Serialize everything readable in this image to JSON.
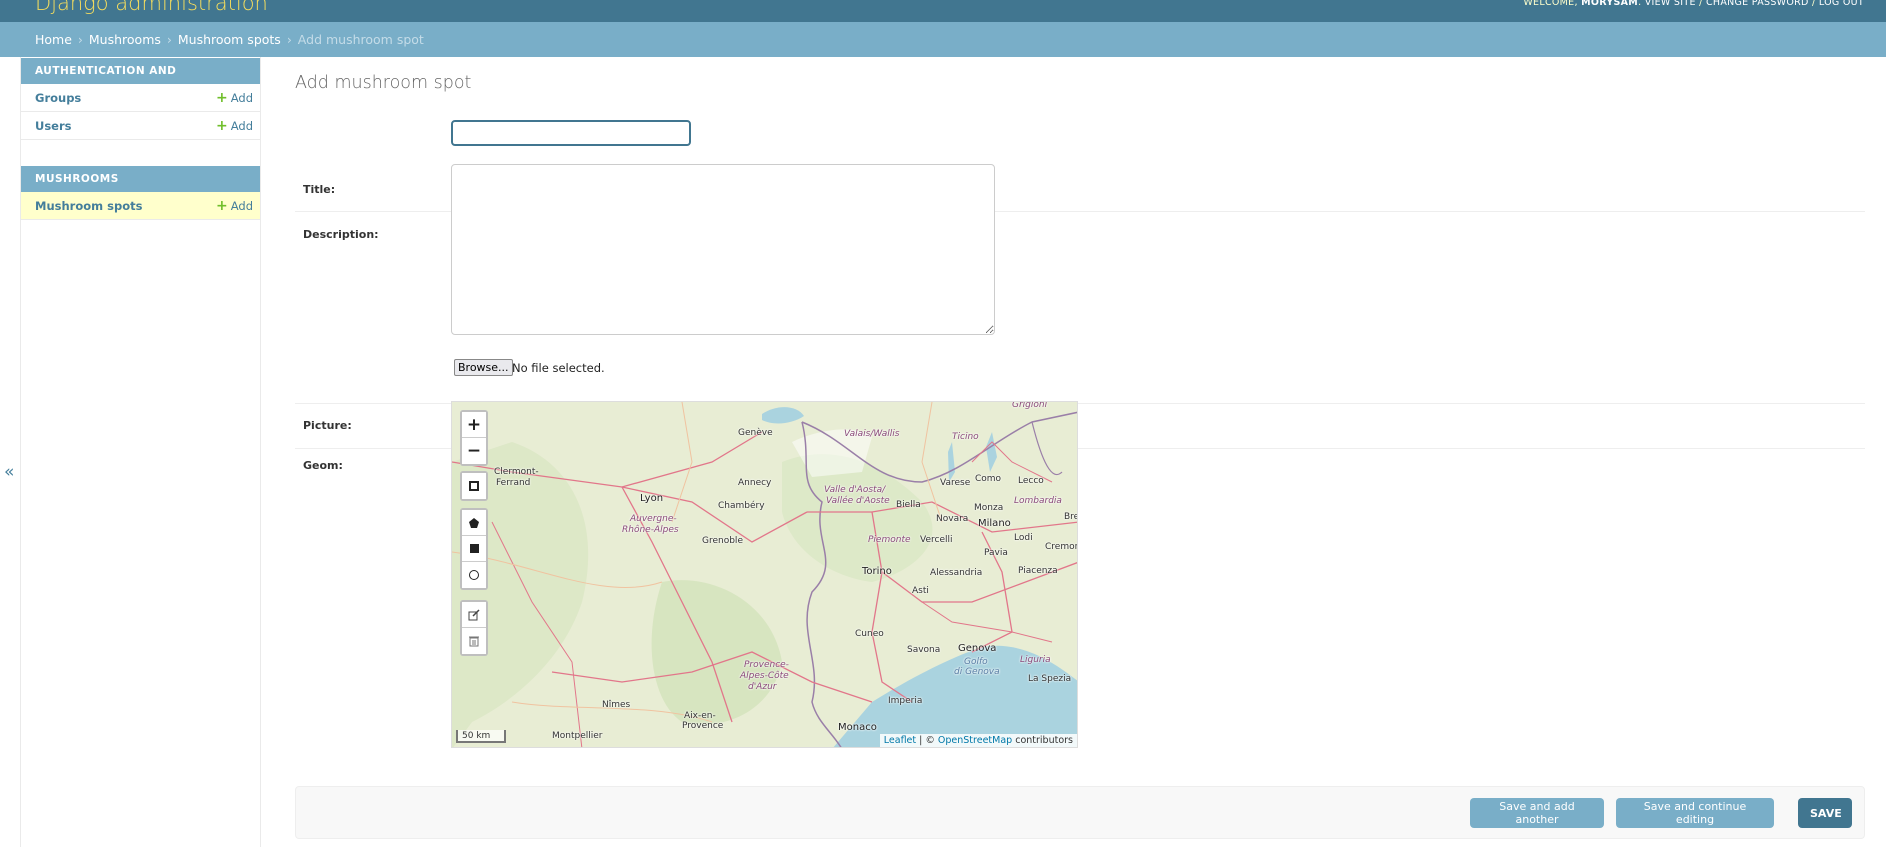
{
  "header": {
    "site_name": "Django administration",
    "welcome": "WELCOME,",
    "username": "MORYSAM",
    "view_site": "VIEW SITE",
    "change_password": "CHANGE PASSWORD",
    "log_out": "LOG OUT",
    "sep": "/"
  },
  "breadcrumbs": {
    "home": "Home",
    "app": "Mushrooms",
    "model": "Mushroom spots",
    "current": "Add mushroom spot",
    "sep": "›"
  },
  "sidebar": {
    "modules": [
      {
        "caption": "Authentication and Authorization",
        "rows": [
          {
            "label": "Groups",
            "add": "Add"
          },
          {
            "label": "Users",
            "add": "Add"
          }
        ]
      },
      {
        "caption": "Mushrooms",
        "rows": [
          {
            "label": "Mushroom spots",
            "add": "Add"
          }
        ]
      }
    ],
    "toggle_icon": "«"
  },
  "page": {
    "title": "Add mushroom spot"
  },
  "form": {
    "title_label": "Title:",
    "title_value": "",
    "description_label": "Description:",
    "description_value": "",
    "picture_label": "Picture:",
    "browse_label": "Browse...",
    "no_file": "No file selected.",
    "geom_label": "Geom:"
  },
  "map": {
    "zoom_in": "+",
    "zoom_out": "−",
    "scale": "50 km",
    "attribution_leaflet": "Leaflet",
    "attribution_mid": " | © ",
    "attribution_osm": "OpenStreetMap",
    "attribution_end": " contributors",
    "places": {
      "geneve": "Genève",
      "valais": "Valais/Wallis",
      "ticino": "Ticino",
      "grigioni": "Grigioni",
      "clermont": "Clermont-",
      "ferrand": "Ferrand",
      "annecy": "Annecy",
      "lyon": "Lyon",
      "auvergne": "Auvergne-",
      "rhone_alpes": "Rhône-Alpes",
      "chambery": "Chambéry",
      "valle_aosta": "Valle d'Aosta/",
      "vallee_aoste": "Vallée d'Aoste",
      "varese": "Varese",
      "como": "Como",
      "lecco": "Lecco",
      "lombardia": "Lombardia",
      "biella": "Biella",
      "novara": "Novara",
      "monza": "Monza",
      "milano": "Milano",
      "bre": "Bre",
      "grenoble": "Grenoble",
      "piemonte": "Piemonte",
      "vercelli": "Vercelli",
      "lodi": "Lodi",
      "pavia": "Pavia",
      "cremona": "Cremon",
      "torino": "Torino",
      "alessandria": "Alessandria",
      "piacenza": "Piacenza",
      "asti": "Asti",
      "cuneo": "Cuneo",
      "savona": "Savona",
      "genova": "Genova",
      "golfo": "Golfo",
      "di_genova": "di Genova",
      "liguria": "Liguria",
      "provence": "Provence-",
      "alpes_cote": "Alpes-Côte",
      "azur": "d'Azur",
      "la_spezia": "La Spezia",
      "imperia": "Imperia",
      "nimes": "Nîmes",
      "aix": "Aix-en-",
      "provence2": "Provence",
      "montpellier": "Montpellier",
      "monaco": "Monaco"
    }
  },
  "submit": {
    "save_add": "Save and add another",
    "save_continue": "Save and continue editing",
    "save": "SAVE"
  },
  "colors": {
    "header": "#417690",
    "breadcrumbs": "#79aec8",
    "site_name": "#f5dd5d",
    "link": "#447e9b",
    "add_plus": "#70bf2b",
    "current_row": "#ffffcc"
  }
}
